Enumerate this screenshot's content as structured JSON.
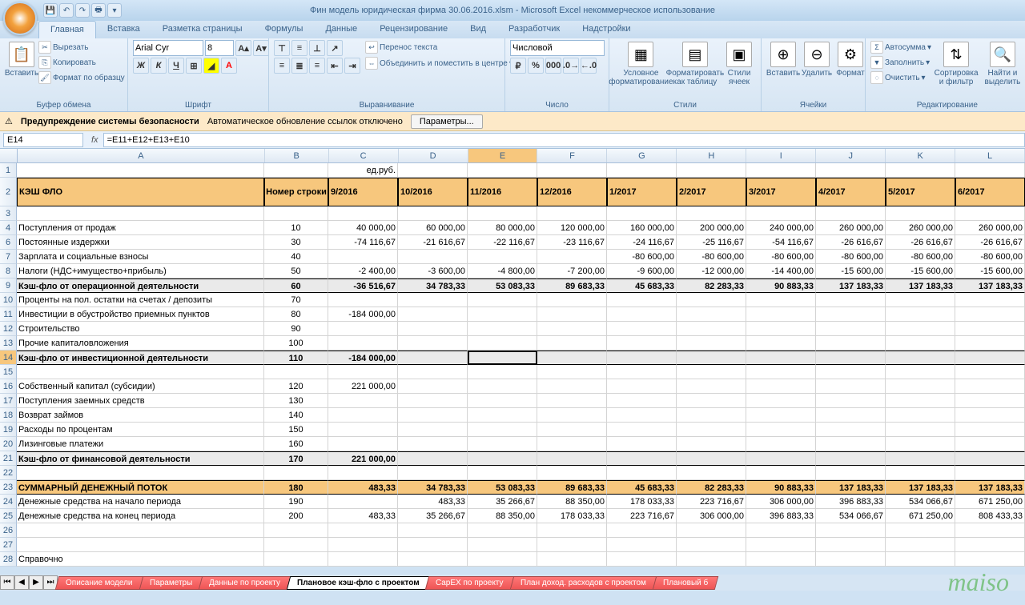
{
  "title": "Фин модель юридическая фирма 30.06.2016.xlsm - Microsoft Excel некоммерческое использование",
  "ribbon": {
    "tabs": [
      "Главная",
      "Вставка",
      "Разметка страницы",
      "Формулы",
      "Данные",
      "Рецензирование",
      "Вид",
      "Разработчик",
      "Надстройки"
    ],
    "clipboard": {
      "label": "Буфер обмена",
      "paste": "Вставить",
      "cut": "Вырезать",
      "copy": "Копировать",
      "format_painter": "Формат по образцу"
    },
    "font": {
      "label": "Шрифт",
      "name": "Arial Cyr",
      "size": "8"
    },
    "align": {
      "label": "Выравнивание",
      "wrap": "Перенос текста",
      "merge": "Объединить и поместить в центре"
    },
    "number": {
      "label": "Число",
      "format": "Числовой"
    },
    "styles": {
      "label": "Стили",
      "cond": "Условное форматирование",
      "table": "Форматировать как таблицу",
      "cell": "Стили ячеек"
    },
    "cells": {
      "label": "Ячейки",
      "insert": "Вставить",
      "delete": "Удалить",
      "format": "Формат"
    },
    "editing": {
      "label": "Редактирование",
      "sum": "Автосумма",
      "fill": "Заполнить",
      "clear": "Очистить",
      "sort": "Сортировка и фильтр",
      "find": "Найти и выделить"
    }
  },
  "security": {
    "title": "Предупреждение системы безопасности",
    "msg": "Автоматическое обновление ссылок отключено",
    "btn": "Параметры..."
  },
  "namebox": "E14",
  "formula": "=E11+E12+E13+E10",
  "columns": [
    "A",
    "B",
    "C",
    "D",
    "E",
    "F",
    "G",
    "H",
    "I",
    "J",
    "K",
    "L"
  ],
  "unit": "ед.руб.",
  "header": {
    "title": "КЭШ ФЛО",
    "rowno": "Номер строки",
    "periods": [
      "9/2016",
      "10/2016",
      "11/2016",
      "12/2016",
      "1/2017",
      "2/2017",
      "3/2017",
      "4/2017",
      "5/2017",
      "6/2017"
    ]
  },
  "rows": [
    {
      "n": 3,
      "label": "",
      "no": "",
      "v": [
        "",
        "",
        "",
        "",
        "",
        "",
        "",
        "",
        "",
        ""
      ]
    },
    {
      "n": 4,
      "label": "Поступления от продаж",
      "no": "10",
      "v": [
        "40 000,00",
        "60 000,00",
        "80 000,00",
        "120 000,00",
        "160 000,00",
        "200 000,00",
        "240 000,00",
        "260 000,00",
        "260 000,00",
        "260 000,00"
      ]
    },
    {
      "n": 6,
      "label": "Постоянные издержки",
      "no": "30",
      "v": [
        "-74 116,67",
        "-21 616,67",
        "-22 116,67",
        "-23 116,67",
        "-24 116,67",
        "-25 116,67",
        "-54 116,67",
        "-26 616,67",
        "-26 616,67",
        "-26 616,67"
      ]
    },
    {
      "n": 7,
      "label": "Зарплата и социальные взносы",
      "no": "40",
      "v": [
        "",
        "",
        "",
        "",
        "-80 600,00",
        "-80 600,00",
        "-80 600,00",
        "-80 600,00",
        "-80 600,00",
        "-80 600,00"
      ]
    },
    {
      "n": 8,
      "label": "Налоги (НДС+имущество+прибыль)",
      "no": "50",
      "v": [
        "-2 400,00",
        "-3 600,00",
        "-4 800,00",
        "-7 200,00",
        "-9 600,00",
        "-12 000,00",
        "-14 400,00",
        "-15 600,00",
        "-15 600,00",
        "-15 600,00"
      ]
    },
    {
      "n": 9,
      "label": "Кэш-фло от операционной деятельности",
      "no": "60",
      "bold": true,
      "v": [
        "-36 516,67",
        "34 783,33",
        "53 083,33",
        "89 683,33",
        "45 683,33",
        "82 283,33",
        "90 883,33",
        "137 183,33",
        "137 183,33",
        "137 183,33"
      ]
    },
    {
      "n": 10,
      "label": "Проценты на пол. остатки на счетах / депозиты",
      "no": "70",
      "v": [
        "",
        "",
        "",
        "",
        "",
        "",
        "",
        "",
        "",
        ""
      ]
    },
    {
      "n": 11,
      "label": "Инвестиции в обустройство приемных пунктов",
      "no": "80",
      "v": [
        "-184 000,00",
        "",
        "",
        "",
        "",
        "",
        "",
        "",
        "",
        ""
      ]
    },
    {
      "n": 12,
      "label": "Строительство",
      "no": "90",
      "v": [
        "",
        "",
        "",
        "",
        "",
        "",
        "",
        "",
        "",
        ""
      ]
    },
    {
      "n": 13,
      "label": "Прочие капиталовложения",
      "no": "100",
      "v": [
        "",
        "",
        "",
        "",
        "",
        "",
        "",
        "",
        "",
        ""
      ]
    },
    {
      "n": 14,
      "label": "Кэш-фло от инвестиционной деятельности",
      "no": "110",
      "bold": true,
      "v": [
        "-184 000,00",
        "",
        "",
        "",
        "",
        "",
        "",
        "",
        "",
        ""
      ]
    },
    {
      "n": 15,
      "label": "",
      "no": "",
      "v": [
        "",
        "",
        "",
        "",
        "",
        "",
        "",
        "",
        "",
        ""
      ]
    },
    {
      "n": 16,
      "label": "Собственный капитал (субсидии)",
      "no": "120",
      "v": [
        "221 000,00",
        "",
        "",
        "",
        "",
        "",
        "",
        "",
        "",
        ""
      ]
    },
    {
      "n": 17,
      "label": "Поступления заемных средств",
      "no": "130",
      "v": [
        "",
        "",
        "",
        "",
        "",
        "",
        "",
        "",
        "",
        ""
      ]
    },
    {
      "n": 18,
      "label": "Возврат займов",
      "no": "140",
      "v": [
        "",
        "",
        "",
        "",
        "",
        "",
        "",
        "",
        "",
        ""
      ]
    },
    {
      "n": 19,
      "label": "Расходы по процентам",
      "no": "150",
      "v": [
        "",
        "",
        "",
        "",
        "",
        "",
        "",
        "",
        "",
        ""
      ]
    },
    {
      "n": 20,
      "label": "Лизинговые платежи",
      "no": "160",
      "v": [
        "",
        "",
        "",
        "",
        "",
        "",
        "",
        "",
        "",
        ""
      ]
    },
    {
      "n": 21,
      "label": "Кэш-фло от финансовой деятельности",
      "no": "170",
      "bold": true,
      "v": [
        "221 000,00",
        "",
        "",
        "",
        "",
        "",
        "",
        "",
        "",
        ""
      ]
    },
    {
      "n": 22,
      "label": "",
      "no": "",
      "v": [
        "",
        "",
        "",
        "",
        "",
        "",
        "",
        "",
        "",
        ""
      ]
    },
    {
      "n": 23,
      "label": "СУММАРНЫЙ ДЕНЕЖНЫЙ ПОТОК",
      "no": "180",
      "sum": true,
      "v": [
        "483,33",
        "34 783,33",
        "53 083,33",
        "89 683,33",
        "45 683,33",
        "82 283,33",
        "90 883,33",
        "137 183,33",
        "137 183,33",
        "137 183,33"
      ]
    },
    {
      "n": 24,
      "label": "Денежные средства на начало периода",
      "no": "190",
      "v": [
        "",
        "483,33",
        "35 266,67",
        "88 350,00",
        "178 033,33",
        "223 716,67",
        "306 000,00",
        "396 883,33",
        "534 066,67",
        "671 250,00"
      ]
    },
    {
      "n": 25,
      "label": "Денежные средства на конец периода",
      "no": "200",
      "v": [
        "483,33",
        "35 266,67",
        "88 350,00",
        "178 033,33",
        "223 716,67",
        "306 000,00",
        "396 883,33",
        "534 066,67",
        "671 250,00",
        "808 433,33"
      ]
    },
    {
      "n": 26,
      "label": "",
      "no": "",
      "v": [
        "",
        "",
        "",
        "",
        "",
        "",
        "",
        "",
        "",
        ""
      ]
    },
    {
      "n": 27,
      "label": "",
      "no": "",
      "v": [
        "",
        "",
        "",
        "",
        "",
        "",
        "",
        "",
        "",
        ""
      ]
    },
    {
      "n": 28,
      "label": "Справочно",
      "no": "",
      "v": [
        "",
        "",
        "",
        "",
        "",
        "",
        "",
        "",
        "",
        ""
      ]
    }
  ],
  "sheets": [
    "Описание модели",
    "Параметры",
    "Данные по проекту",
    "Плановое кэш-фло с проектом",
    "CapEX по проекту",
    "План доход. расходов с проектом",
    "Плановый б"
  ],
  "active_sheet": 3,
  "watermark": "maiso"
}
